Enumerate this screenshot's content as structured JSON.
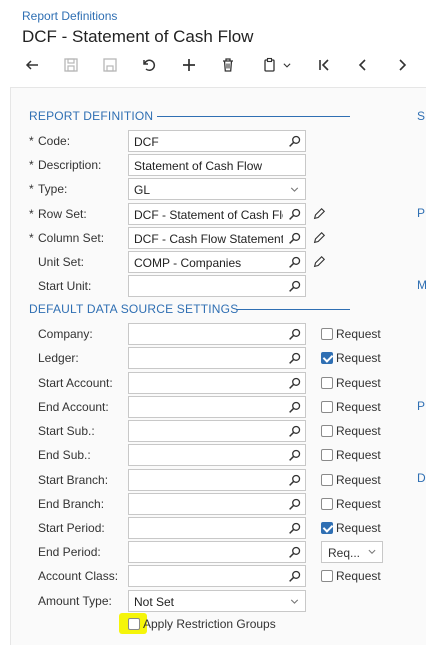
{
  "header": {
    "breadcrumb": "Report Definitions",
    "title": "DCF - Statement of Cash Flow"
  },
  "toolbar": {
    "buttons": [
      {
        "name": "back-button",
        "icon": "back-arrow-icon",
        "enabled": true
      },
      {
        "name": "save-close-button",
        "icon": "save-close-icon",
        "enabled": false
      },
      {
        "name": "save-button",
        "icon": "save-icon",
        "enabled": false
      },
      {
        "name": "undo-button",
        "icon": "undo-icon",
        "enabled": true
      },
      {
        "name": "add-button",
        "icon": "plus-icon",
        "enabled": true
      },
      {
        "name": "delete-button",
        "icon": "trash-icon",
        "enabled": true
      },
      {
        "name": "copy-paste-button",
        "icon": "clipboard-icon",
        "enabled": true
      },
      {
        "name": "first-button",
        "icon": "first-record-icon",
        "enabled": true
      },
      {
        "name": "prev-button",
        "icon": "chevron-left-icon",
        "enabled": true
      },
      {
        "name": "next-button",
        "icon": "chevron-right-icon",
        "enabled": true
      }
    ]
  },
  "report_definition": {
    "section_title": "REPORT DEFINITION",
    "code": {
      "label": "Code:",
      "value": "DCF"
    },
    "description": {
      "label": "Description:",
      "value": "Statement of Cash Flow"
    },
    "type": {
      "label": "Type:",
      "value": "GL"
    },
    "row_set": {
      "label": "Row Set:",
      "value": "DCF - Statement of Cash Flo"
    },
    "column_set": {
      "label": "Column Set:",
      "value": "DCF - Cash Flow Statement"
    },
    "unit_set": {
      "label": "Unit Set:",
      "value": "COMP - Companies"
    },
    "start_unit": {
      "label": "Start Unit:",
      "value": ""
    }
  },
  "default_data_source": {
    "section_title": "DEFAULT DATA SOURCE SETTINGS",
    "company": {
      "label": "Company:",
      "value": "",
      "request_label": "Request",
      "request": false
    },
    "ledger": {
      "label": "Ledger:",
      "value": "",
      "request_label": "Request",
      "request": true
    },
    "start_account": {
      "label": "Start Account:",
      "value": "",
      "request_label": "Request",
      "request": false
    },
    "end_account": {
      "label": "End Account:",
      "value": "",
      "request_label": "Request",
      "request": false
    },
    "start_sub": {
      "label": "Start Sub.:",
      "value": "",
      "request_label": "Request",
      "request": false
    },
    "end_sub": {
      "label": "End Sub.:",
      "value": "",
      "request_label": "Request",
      "request": false
    },
    "start_branch": {
      "label": "Start Branch:",
      "value": "",
      "request_label": "Request",
      "request": false
    },
    "end_branch": {
      "label": "End Branch:",
      "value": "",
      "request_label": "Request",
      "request": false
    },
    "start_period": {
      "label": "Start Period:",
      "value": "",
      "request_label": "Request",
      "request": true
    },
    "end_period": {
      "label": "End Period:",
      "value": "",
      "request_select": "Req..."
    },
    "account_class": {
      "label": "Account Class:",
      "value": "",
      "request_label": "Request",
      "request": false
    },
    "amount_type": {
      "label": "Amount Type:",
      "value": "Not Set"
    }
  },
  "apply_restriction_groups": {
    "label": "Apply Restriction Groups",
    "checked": false,
    "highlight_color": "#f5f50a"
  },
  "right_column_letters": [
    "S",
    "P",
    "M",
    "P",
    "D"
  ],
  "colors": {
    "accent": "#2f6fb3",
    "check_on": "#2f6fb3"
  }
}
